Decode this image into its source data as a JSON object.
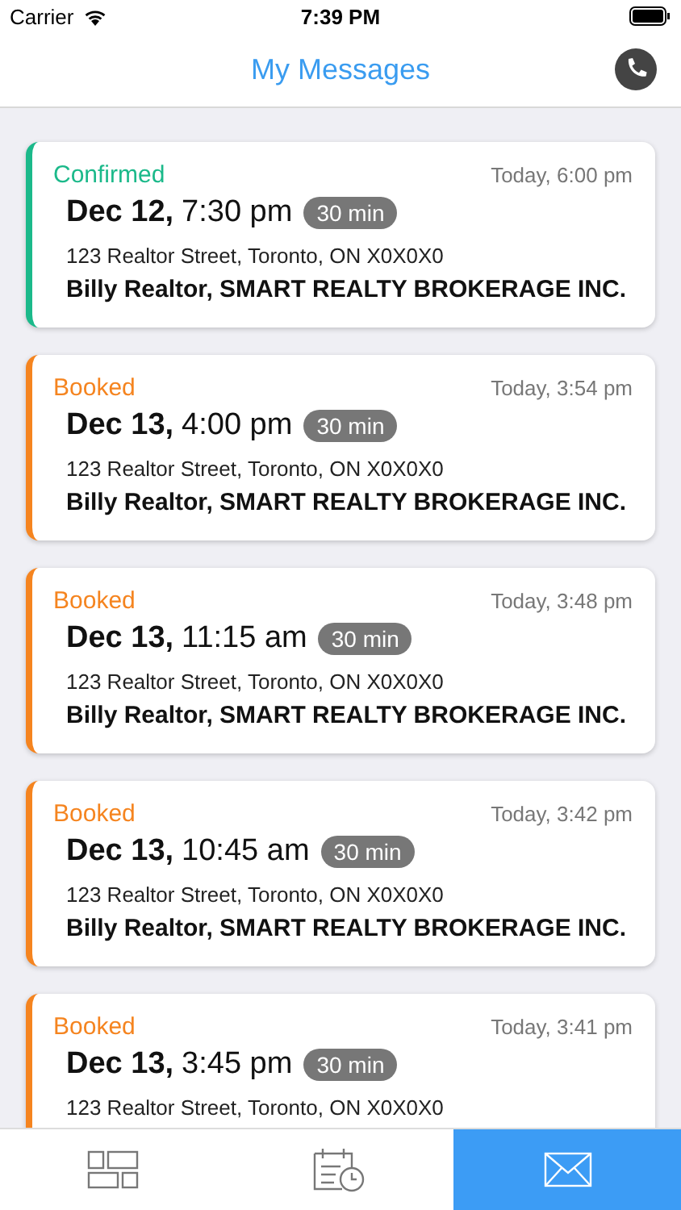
{
  "status_bar": {
    "carrier": "Carrier",
    "time": "7:39 PM"
  },
  "nav": {
    "title": "My Messages"
  },
  "messages": [
    {
      "status": "Confirmed",
      "kind": "confirmed",
      "received": "Today, 6:00 pm",
      "date": "Dec 12,",
      "time": "7:30 pm",
      "duration": "30 min",
      "address": "123 Realtor Street, Toronto, ON X0X0X0",
      "agent": "Billy Realtor, SMART REALTY BROKERAGE INC."
    },
    {
      "status": "Booked",
      "kind": "booked",
      "received": "Today, 3:54 pm",
      "date": "Dec 13,",
      "time": "4:00 pm",
      "duration": "30 min",
      "address": "123 Realtor Street, Toronto, ON X0X0X0",
      "agent": "Billy Realtor, SMART REALTY BROKERAGE INC."
    },
    {
      "status": "Booked",
      "kind": "booked",
      "received": "Today, 3:48 pm",
      "date": "Dec 13,",
      "time": "11:15 am",
      "duration": "30 min",
      "address": "123 Realtor Street, Toronto, ON X0X0X0",
      "agent": "Billy Realtor, SMART REALTY BROKERAGE INC."
    },
    {
      "status": "Booked",
      "kind": "booked",
      "received": "Today, 3:42 pm",
      "date": "Dec 13,",
      "time": "10:45 am",
      "duration": "30 min",
      "address": "123 Realtor Street, Toronto, ON X0X0X0",
      "agent": "Billy Realtor, SMART REALTY BROKERAGE INC."
    },
    {
      "status": "Booked",
      "kind": "booked",
      "received": "Today, 3:41 pm",
      "date": "Dec 13,",
      "time": "3:45 pm",
      "duration": "30 min",
      "address": "123 Realtor Street, Toronto, ON X0X0X0"
    }
  ],
  "tab_bar": [
    {
      "kind": "dashboard",
      "selected": false
    },
    {
      "kind": "schedule",
      "selected": false
    },
    {
      "kind": "messages",
      "selected": true
    }
  ]
}
